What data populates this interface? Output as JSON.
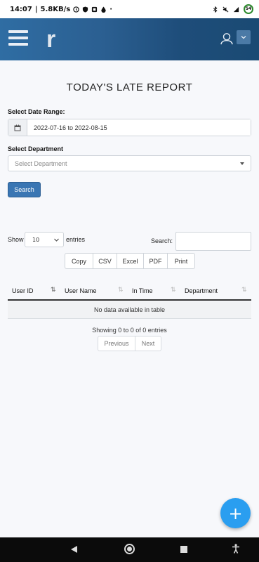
{
  "status_bar": {
    "time": "14:07",
    "speed": "5.8KB/s",
    "battery_level": "54"
  },
  "header": {
    "logo_text": "r"
  },
  "page": {
    "title": "TODAY'S LATE REPORT"
  },
  "filters": {
    "date_range_label": "Select Date Range:",
    "date_range_value": "2022-07-16 to 2022-08-15",
    "department_label": "Select Department",
    "department_placeholder": "Select Department",
    "search_button": "Search"
  },
  "table_controls": {
    "show_label": "Show",
    "entries_value": "10",
    "entries_label": "entries",
    "search_label": "Search:",
    "export_buttons": [
      "Copy",
      "CSV",
      "Excel",
      "PDF",
      "Print"
    ]
  },
  "table": {
    "columns": [
      "User ID",
      "User Name",
      "In Time",
      "Department"
    ],
    "empty_message": "No data available in table",
    "info": "Showing 0 to 0 of 0 entries",
    "pager": {
      "previous": "Previous",
      "next": "Next"
    }
  },
  "fab": {
    "label": "+"
  },
  "colors": {
    "header_start": "#2f6da3",
    "header_end": "#1a4a73",
    "primary_button": "#3a76b3",
    "fab": "#2a9ef0"
  }
}
